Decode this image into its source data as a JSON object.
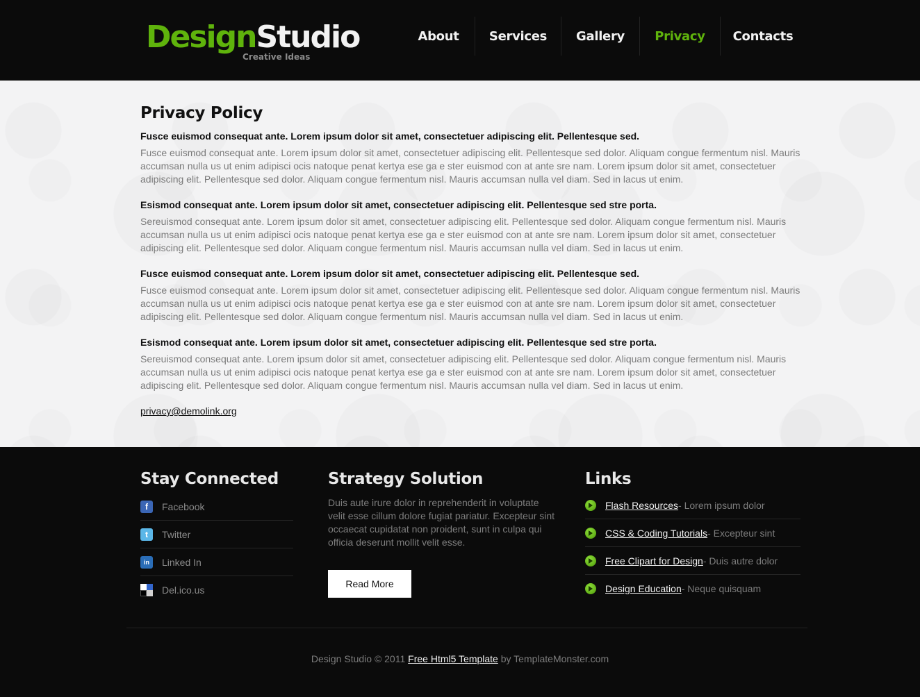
{
  "header": {
    "logo": {
      "part1": "Design",
      "part2": "Studio",
      "tagline": "Creative Ideas"
    },
    "nav": [
      {
        "label": "About",
        "active": false
      },
      {
        "label": "Services",
        "active": false
      },
      {
        "label": "Gallery",
        "active": false
      },
      {
        "label": "Privacy",
        "active": true
      },
      {
        "label": "Contacts",
        "active": false
      }
    ],
    "colors": {
      "accent": "#5fb30c",
      "background": "#0b0b0b"
    }
  },
  "main": {
    "title": "Privacy Policy",
    "blocks": [
      {
        "heading": "Fusce euismod consequat ante. Lorem ipsum dolor sit amet, consectetuer adipiscing elit. Pellentesque sed.",
        "text": "Fusce euismod consequat ante. Lorem ipsum dolor sit amet, consectetuer adipiscing elit. Pellentesque sed dolor. Aliquam congue fermentum nisl. Mauris accumsan nulla us ut enim adipisci ocis natoque penat kertya ese ga e ster euismod con at ante sre nam. Lorem ipsum dolor sit amet, consectetuer adipiscing elit. Pellentesque sed dolor. Aliquam congue fermentum nisl. Mauris accumsan nulla vel diam. Sed in lacus ut enim."
      },
      {
        "heading": "Esismod consequat ante. Lorem ipsum dolor sit amet, consectetuer adipiscing elit. Pellentesque sed stre porta.",
        "text": "Sereuismod consequat ante. Lorem ipsum dolor sit amet, consectetuer adipiscing elit. Pellentesque sed dolor. Aliquam congue fermentum nisl. Mauris accumsan nulla us ut enim adipisci ocis natoque penat kertya ese ga e ster euismod con at ante sre nam. Lorem ipsum dolor sit amet, consectetuer adipiscing elit. Pellentesque sed dolor. Aliquam congue fermentum nisl. Mauris accumsan nulla vel diam. Sed in lacus ut enim."
      },
      {
        "heading": "Fusce euismod consequat ante. Lorem ipsum dolor sit amet, consectetuer adipiscing elit. Pellentesque sed.",
        "text": "Fusce euismod consequat ante. Lorem ipsum dolor sit amet, consectetuer adipiscing elit. Pellentesque sed dolor. Aliquam congue fermentum nisl. Mauris accumsan nulla us ut enim adipisci ocis natoque penat kertya ese ga e ster euismod con at ante sre nam. Lorem ipsum dolor sit amet, consectetuer adipiscing elit. Pellentesque sed dolor. Aliquam congue fermentum nisl. Mauris accumsan nulla vel diam. Sed in lacus ut enim."
      },
      {
        "heading": "Esismod consequat ante. Lorem ipsum dolor sit amet, consectetuer adipiscing elit. Pellentesque sed stre porta.",
        "text": "Sereuismod consequat ante. Lorem ipsum dolor sit amet, consectetuer adipiscing elit. Pellentesque sed dolor. Aliquam congue fermentum nisl. Mauris accumsan nulla us ut enim adipisci ocis natoque penat kertya ese ga e ster euismod con at ante sre nam. Lorem ipsum dolor sit amet, consectetuer adipiscing elit. Pellentesque sed dolor. Aliquam congue fermentum nisl. Mauris accumsan nulla vel diam. Sed in lacus ut enim."
      }
    ],
    "email": "privacy@demolink.org"
  },
  "footer": {
    "stay_connected": {
      "title": "Stay Connected",
      "items": [
        {
          "label": "Facebook",
          "icon": "facebook-icon"
        },
        {
          "label": "Twitter",
          "icon": "twitter-icon"
        },
        {
          "label": "Linked In",
          "icon": "linkedin-icon"
        },
        {
          "label": "Del.ico.us",
          "icon": "delicious-icon"
        }
      ]
    },
    "strategy": {
      "title": "Strategy Solution",
      "text": "Duis aute irure dolor in reprehenderit in voluptate velit esse cillum dolore fugiat pariatur. Excepteur sint occaecat cupidatat non proident, sunt in culpa qui officia deserunt mollit velit esse.",
      "button_label": "Read More"
    },
    "links": {
      "title": "Links",
      "items": [
        {
          "label": "Flash Resources",
          "desc": " - Lorem ipsum dolor"
        },
        {
          "label": "CSS & Coding Tutorials",
          "desc": " - Excepteur sint"
        },
        {
          "label": "Free Clipart for Design",
          "desc": " - Duis autre dolor"
        },
        {
          "label": "Design Education",
          "desc": " - Neque quisquam"
        }
      ]
    },
    "copyright": {
      "prefix": "Design Studio © 2011 ",
      "link": "Free Html5 Template",
      "suffix": " by TemplateMonster.com"
    }
  }
}
